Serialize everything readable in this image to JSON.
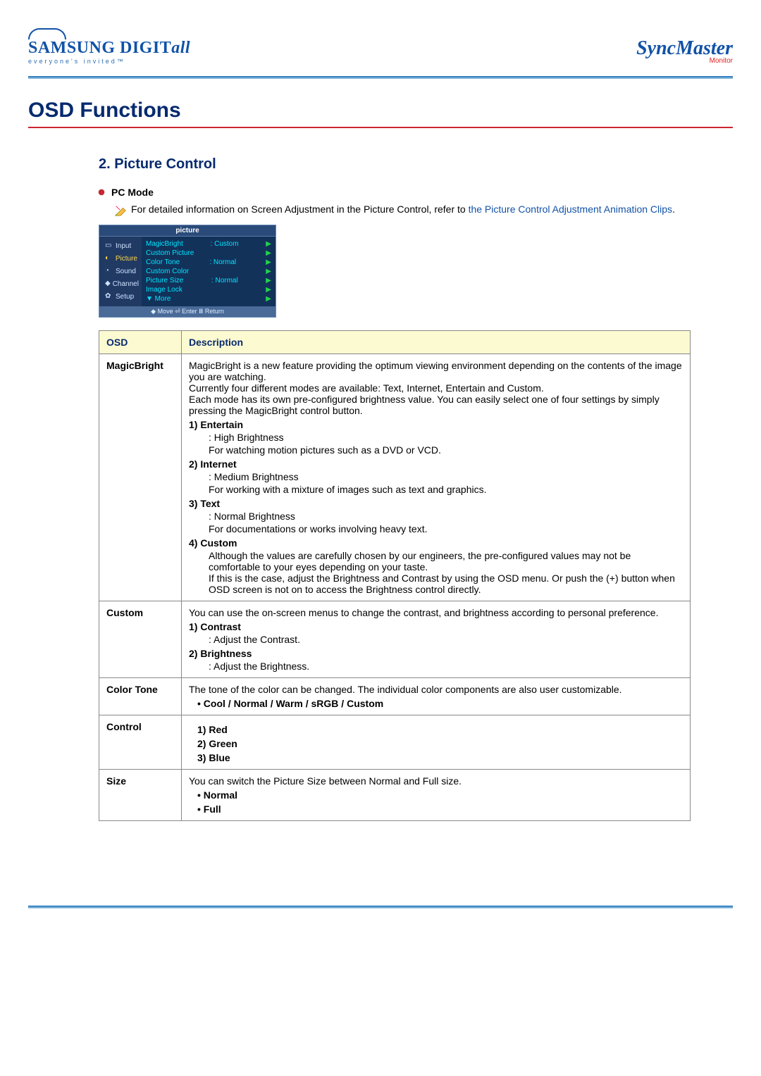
{
  "brand": {
    "left_main_a": "SAMSUNG DIGIT",
    "left_main_b": "all",
    "left_tag": "everyone's invited™",
    "right_main": "SyncMaster",
    "right_sub": "Monitor"
  },
  "title": "OSD Functions",
  "section_title": "2. Picture Control",
  "pc_mode_label": "PC Mode",
  "intro_plain": "For detailed information on Screen Adjustment in the Picture Control, refer to ",
  "intro_link": "the Picture Control Adjustment Animation Clips",
  "intro_period": ".",
  "osd_img": {
    "top": "picture",
    "side": [
      "Input",
      "Picture",
      "Sound",
      "Channel",
      "Setup"
    ],
    "rows": [
      {
        "n": "MagicBright",
        "v": ": Custom"
      },
      {
        "n": "Custom Picture",
        "v": ""
      },
      {
        "n": "Color Tone",
        "v": ": Normal"
      },
      {
        "n": "Custom Color",
        "v": ""
      },
      {
        "n": "Picture Size",
        "v": ": Normal"
      },
      {
        "n": "Image Lock",
        "v": ""
      },
      {
        "n": "▼ More",
        "v": ""
      }
    ],
    "foot": "◆ Move   ⏎ Enter   Ⅲ Return"
  },
  "table": {
    "head_osd": "OSD",
    "head_desc": "Description",
    "rows": {
      "r1": {
        "osd": "MagicBright",
        "intro": "MagicBright is a new feature providing the optimum viewing environment depending on the contents of the image you are watching.\nCurrently four different modes are available: Text, Internet, Entertain and Custom.\nEach mode has its own pre-configured brightness value. You can easily select one of four settings by simply pressing the MagicBright control button.",
        "i1": "1) Entertain",
        "i1a": ": High Brightness",
        "i1b": "For watching motion pictures such as a DVD or VCD.",
        "i2": "2) Internet",
        "i2a": ": Medium Brightness",
        "i2b": "For working with a mixture of images such as text and graphics.",
        "i3": "3) Text",
        "i3a": ": Normal Brightness",
        "i3b": "For documentations or works involving heavy text.",
        "i4": "4) Custom",
        "i4a": "Although the values are carefully chosen by our engineers, the pre-configured values may not be comfortable to your eyes depending on your taste.\nIf this is the case, adjust the Brightness and Contrast by using the OSD menu. Or push the (+) button when OSD screen is not on to access the Brightness control directly."
      },
      "r2": {
        "osd": "Custom",
        "intro": "You can use the on-screen menus to change the contrast, and brightness according to personal preference.",
        "i1": "1) Contrast",
        "i1a": ": Adjust the Contrast.",
        "i2": "2) Brightness",
        "i2a": ": Adjust the Brightness."
      },
      "r3": {
        "osd": "Color Tone",
        "intro": "The tone of the color can be changed. The individual color components are also user customizable.",
        "i1": "• Cool / Normal / Warm / sRGB / Custom"
      },
      "r4": {
        "osd": "Control",
        "i1": "1) Red",
        "i2": "2) Green",
        "i3": "3) Blue"
      },
      "r5": {
        "osd": "Size",
        "intro": "You can switch the Picture Size between Normal and Full size.",
        "i1": "• Normal",
        "i2": "• Full"
      }
    }
  }
}
